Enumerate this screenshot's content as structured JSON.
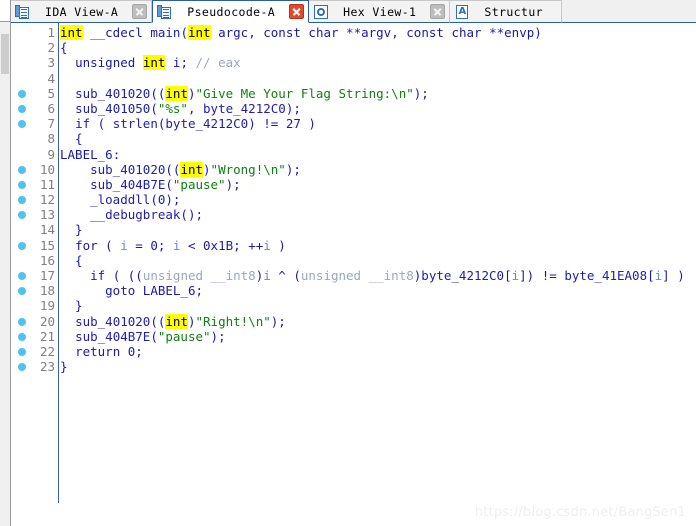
{
  "window": {
    "app": "IDA Pro",
    "active_view": "Pseudocode-A"
  },
  "tabs": [
    {
      "label": "IDA View-A",
      "icon": "document-icon",
      "active": false,
      "close_label": "×"
    },
    {
      "label": "Pseudocode-A",
      "icon": "document-icon",
      "active": true,
      "close_label": "×"
    },
    {
      "label": "Hex View-1",
      "icon": "hex-view-icon",
      "active": false,
      "close_label": "×"
    },
    {
      "label": "Structur",
      "icon": "structures-icon",
      "active": false,
      "close_label": ""
    }
  ],
  "editor": {
    "language": "c-pseudocode",
    "first_line": 1,
    "last_line": 23,
    "breakpoint_lines": [
      5,
      6,
      7,
      10,
      11,
      12,
      13,
      15,
      17,
      18,
      20,
      21,
      22,
      23
    ],
    "lines": [
      {
        "n": "1",
        "bp": false,
        "html": "<span class=\"t-hl\">int</span> <span class=\"t-kw\">__cdecl</span> <span class=\"t-fn\">main</span>(<span class=\"t-hl\">int</span> <span class=\"t-plain\">argc</span>, <span class=\"t-kw\">const</span> <span class=\"t-kw\">char</span> **<span class=\"t-plain\">argv</span>, <span class=\"t-kw\">const</span> <span class=\"t-kw\">char</span> **<span class=\"t-plain\">envp</span>)"
      },
      {
        "n": "2",
        "bp": false,
        "html": "{"
      },
      {
        "n": "3",
        "bp": false,
        "html": "  <span class=\"t-kw\">unsigned</span> <span class=\"t-hl\">int</span> <span class=\"t-plain\">i</span>; <span class=\"t-cmt\">// eax</span>"
      },
      {
        "n": "4",
        "bp": false,
        "html": ""
      },
      {
        "n": "5",
        "bp": true,
        "html": "  <span class=\"t-fn\">sub_401020</span>((<span class=\"t-hl\">int</span>)<span class=\"t-str\">\"Give Me Your Flag String:\\n\"</span>);"
      },
      {
        "n": "6",
        "bp": true,
        "html": "  <span class=\"t-fn\">sub_401050</span>(<span class=\"t-str\">\"%s\"</span>, <span class=\"t-fn\">byte_4212C0</span>);"
      },
      {
        "n": "7",
        "bp": true,
        "html": "  <span class=\"t-kw\">if</span> ( <span class=\"t-fn\">strlen</span>(<span class=\"t-fn\">byte_4212C0</span>) != <span class=\"t-num\">27</span> )"
      },
      {
        "n": "8",
        "bp": false,
        "html": "  {"
      },
      {
        "n": "9",
        "bp": false,
        "html": "<span class=\"t-label\">LABEL_6</span>:"
      },
      {
        "n": "10",
        "bp": true,
        "html": "    <span class=\"t-fn\">sub_401020</span>((<span class=\"t-hl\">int</span>)<span class=\"t-str\">\"Wrong!\\n\"</span>);"
      },
      {
        "n": "11",
        "bp": true,
        "html": "    <span class=\"t-fn\">sub_404B7E</span>(<span class=\"t-str\">\"pause\"</span>);"
      },
      {
        "n": "12",
        "bp": true,
        "html": "    <span class=\"t-fn\">_loaddll</span>(<span class=\"t-num\">0</span>);"
      },
      {
        "n": "13",
        "bp": true,
        "html": "    <span class=\"t-fn\">__debugbreak</span>();"
      },
      {
        "n": "14",
        "bp": false,
        "html": "  }"
      },
      {
        "n": "15",
        "bp": true,
        "html": "  <span class=\"t-kw\">for</span> ( <span class=\"t-var\">i</span> = <span class=\"t-num\">0</span>; <span class=\"t-var\">i</span> &lt; <span class=\"t-num\">0x1B</span>; ++<span class=\"t-var\">i</span> )"
      },
      {
        "n": "16",
        "bp": false,
        "html": "  {"
      },
      {
        "n": "17",
        "bp": true,
        "html": "    <span class=\"t-kw\">if</span> ( ((<span class=\"t-type\">unsigned __int8</span>)<span class=\"t-var\">i</span> ^ (<span class=\"t-type\">unsigned __int8</span>)<span class=\"t-fn\">byte_4212C0</span>[<span class=\"t-var\">i</span>]) != <span class=\"t-fn\">byte_41EA08</span>[<span class=\"t-var\">i</span>] )"
      },
      {
        "n": "18",
        "bp": true,
        "html": "      <span class=\"t-kw\">goto</span> <span class=\"t-label\">LABEL_6</span>;"
      },
      {
        "n": "19",
        "bp": false,
        "html": "  }"
      },
      {
        "n": "20",
        "bp": true,
        "html": "  <span class=\"t-fn\">sub_401020</span>((<span class=\"t-hl\">int</span>)<span class=\"t-str\">\"Right!\\n\"</span>);"
      },
      {
        "n": "21",
        "bp": true,
        "html": "  <span class=\"t-fn\">sub_404B7E</span>(<span class=\"t-str\">\"pause\"</span>);"
      },
      {
        "n": "22",
        "bp": true,
        "html": "  <span class=\"t-kw\">return</span> <span class=\"t-num\">0</span>;"
      },
      {
        "n": "23",
        "bp": true,
        "html": "}"
      }
    ]
  },
  "watermark": {
    "text": "https://blog.csdn.net/BangSen1"
  },
  "colors": {
    "highlight": "#ffff00",
    "keyword": "#1a1aa8",
    "string": "#108010",
    "comment": "#9aa7c0",
    "breakpoint_dot": "#4ec3f0",
    "active_tab_border": "#2a6099",
    "close_button_active": "#e04a32"
  }
}
